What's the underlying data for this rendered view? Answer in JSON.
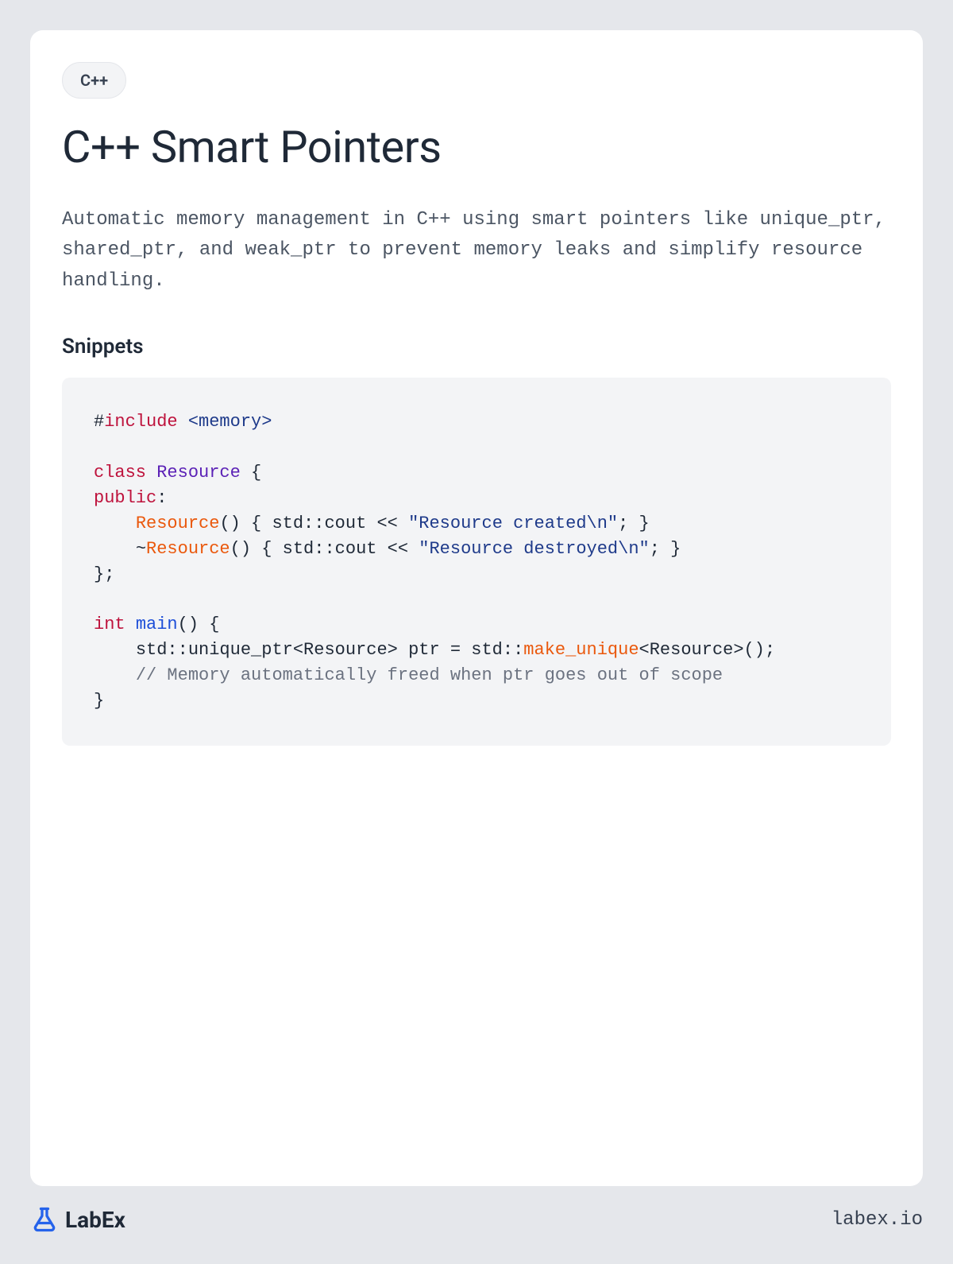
{
  "tag": "C++",
  "title": "C++ Smart Pointers",
  "description": "Automatic memory management in C++ using smart pointers like unique_ptr, shared_ptr, and weak_ptr to prevent memory leaks and simplify resource handling.",
  "snippets_heading": "Snippets",
  "code": {
    "tokens": [
      {
        "t": "#",
        "c": "normal"
      },
      {
        "t": "include",
        "c": "directive"
      },
      {
        "t": " ",
        "c": "normal"
      },
      {
        "t": "<memory>",
        "c": "include-path"
      },
      {
        "t": "\n\n",
        "c": "normal"
      },
      {
        "t": "class",
        "c": "keyword"
      },
      {
        "t": " ",
        "c": "normal"
      },
      {
        "t": "Resource",
        "c": "class-name"
      },
      {
        "t": " {\n",
        "c": "normal"
      },
      {
        "t": "public",
        "c": "keyword"
      },
      {
        "t": ":\n    ",
        "c": "normal"
      },
      {
        "t": "Resource",
        "c": "func"
      },
      {
        "t": "() { std::cout << ",
        "c": "normal"
      },
      {
        "t": "\"Resource created\\n\"",
        "c": "string"
      },
      {
        "t": "; }\n    ~",
        "c": "normal"
      },
      {
        "t": "Resource",
        "c": "func"
      },
      {
        "t": "() { std::cout << ",
        "c": "normal"
      },
      {
        "t": "\"Resource destroyed\\n\"",
        "c": "string"
      },
      {
        "t": "; }\n};\n\n",
        "c": "normal"
      },
      {
        "t": "int",
        "c": "type"
      },
      {
        "t": " ",
        "c": "normal"
      },
      {
        "t": "main",
        "c": "main"
      },
      {
        "t": "() {\n    std::unique_ptr<Resource> ptr = std::",
        "c": "normal"
      },
      {
        "t": "make_unique",
        "c": "func"
      },
      {
        "t": "<Resource>();\n    ",
        "c": "normal"
      },
      {
        "t": "// Memory automatically freed when ptr goes out of scope",
        "c": "comment"
      },
      {
        "t": "\n}",
        "c": "normal"
      }
    ]
  },
  "footer": {
    "brand": "LabEx",
    "url": "labex.io"
  }
}
